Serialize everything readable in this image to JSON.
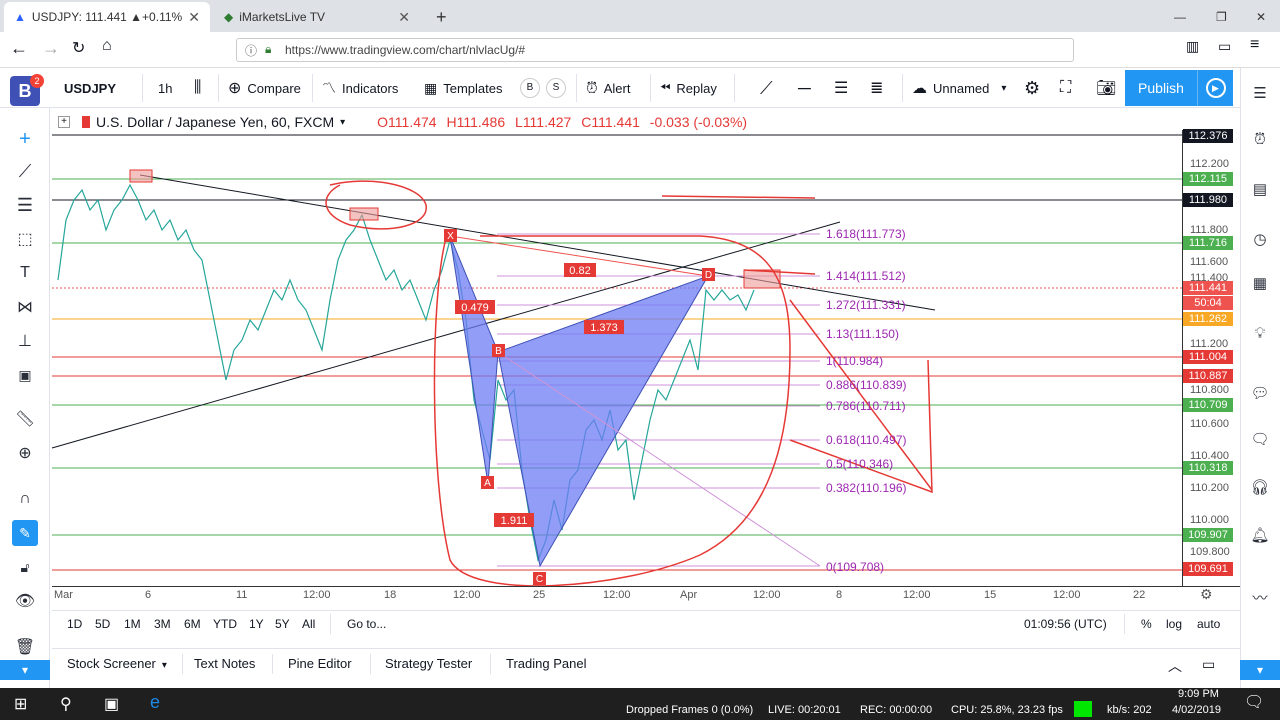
{
  "browser": {
    "tabs": [
      {
        "title": "USDJPY: 111.441 ▲+0.11% — U",
        "close": "✕"
      },
      {
        "title": "iMarketsLive TV",
        "close": "✕"
      }
    ],
    "new_tab": "+",
    "url": "https://www.tradingview.com/chart/nlvlacUg/#",
    "window_controls": [
      "—",
      "❐",
      "✕"
    ]
  },
  "toolbar": {
    "symbol": "USDJPY",
    "interval": "1h",
    "compare": "Compare",
    "indicators": "Indicators",
    "templates": "Templates",
    "templates_b": "B",
    "templates_s": "S",
    "alert": "Alert",
    "replay": "Replay",
    "layout_name": "Unnamed",
    "publish": "Publish",
    "notif_count": "2",
    "user_initial": "B"
  },
  "legend": {
    "title": "U.S. Dollar / Japanese Yen, 60, FXCM",
    "open_label": "O",
    "open": "111.474",
    "high_label": "H",
    "high": "111.486",
    "low_label": "L",
    "low": "111.427",
    "close_label": "C",
    "close": "111.441",
    "change": "-0.033 (-0.03%)"
  },
  "price_axis": {
    "plain_labels": [
      "112.200",
      "111.800",
      "111.600",
      "111.400",
      "111.200",
      "110.800",
      "110.600",
      "110.400",
      "110.200",
      "110.000",
      "109.800"
    ],
    "boxes": [
      {
        "text": "112.376",
        "color": "#131722"
      },
      {
        "text": "112.115",
        "color": "#4caf50"
      },
      {
        "text": "111.980",
        "color": "#131722"
      },
      {
        "text": "111.716",
        "color": "#4caf50"
      },
      {
        "text": "111.441",
        "color": "#ef5350"
      },
      {
        "text": "50:04",
        "color": "#ef5350"
      },
      {
        "text": "111.262",
        "color": "#f9a825"
      },
      {
        "text": "111.004",
        "color": "#e53935"
      },
      {
        "text": "110.887",
        "color": "#e53935"
      },
      {
        "text": "110.709",
        "color": "#4caf50"
      },
      {
        "text": "110.318",
        "color": "#4caf50"
      },
      {
        "text": "109.907",
        "color": "#4caf50"
      },
      {
        "text": "109.691",
        "color": "#e53935"
      }
    ]
  },
  "time_axis": [
    "Mar",
    "6",
    "11",
    "12:00",
    "18",
    "12:00",
    "25",
    "12:00",
    "Apr",
    "12:00",
    "8",
    "12:00",
    "15",
    "12:00",
    "22"
  ],
  "fibonacci": [
    "1.618(111.773)",
    "1.414(111.512)",
    "1.272(111.331)",
    "1.13(111.150)",
    "1(110.984)",
    "0.886(110.839)",
    "0.786(110.711)",
    "0.618(110.497)",
    "0.5(110.346)",
    "0.382(110.196)",
    "0(109.708)"
  ],
  "pattern": {
    "points": [
      "X",
      "A",
      "B",
      "C",
      "D"
    ],
    "ratios": [
      "0.82",
      "0.479",
      "1.373",
      "1.911"
    ]
  },
  "range_bar": {
    "periods": [
      "1D",
      "5D",
      "1M",
      "3M",
      "6M",
      "YTD",
      "1Y",
      "5Y",
      "All"
    ],
    "goto": "Go to...",
    "clock": "01:09:56 (UTC)",
    "percent": "%",
    "log": "log",
    "auto": "auto"
  },
  "bottom_tabs": [
    "Stock Screener",
    "Text Notes",
    "Pine Editor",
    "Strategy Tester",
    "Trading Panel"
  ],
  "taskbar": {
    "stats": [
      "Dropped Frames 0 (0.0%)",
      "LIVE: 00:20:01",
      "REC: 00:00:00",
      "CPU: 25.8%, 23.23 fps",
      "kb/s: 202"
    ],
    "time": "9:09 PM",
    "date": "4/02/2019"
  },
  "colors": {
    "accent": "#2962ff",
    "pattern_fill": "#6c7cf4",
    "annotation": "#e53935",
    "green_line": "#4caf50",
    "fib": "#9c27b0"
  }
}
